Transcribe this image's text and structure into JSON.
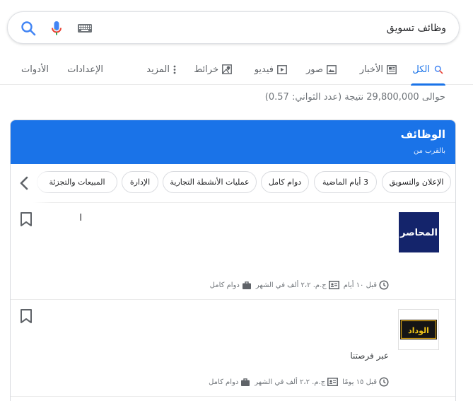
{
  "search": {
    "value": "وظائف تسويق",
    "placeholder": ""
  },
  "tabs": [
    {
      "label": "الكل",
      "icon": "search-icon",
      "active": true
    },
    {
      "label": "الأخبار",
      "icon": "news-icon"
    },
    {
      "label": "صور",
      "icon": "image-icon"
    },
    {
      "label": "فيديو",
      "icon": "video-icon"
    },
    {
      "label": "خرائط",
      "icon": "map-icon"
    },
    {
      "label": "المزيد",
      "icon": "more-vert-icon"
    },
    {
      "label": "الإعدادات"
    },
    {
      "label": "الأدوات"
    }
  ],
  "stats": "حوالى 29,800,000 نتيجة (عدد الثواني: 0.57)",
  "jobs_card": {
    "title": "الوظائف",
    "subtitle": "بالقرب من",
    "chips": [
      "الإعلان والتسويق",
      "3 أيام الماضية",
      "دوام كامل",
      "عمليات الأنشطة التجارية",
      "الإدارة",
      "المبيعات والتجزئة"
    ],
    "jobs": [
      {
        "title": "ا",
        "company": "",
        "posted": "قبل ١٠ أيام",
        "salary": "ج.م. ٢،٢ ألف في الشهر",
        "type": "دوام كامل",
        "logo_text": "المحاصر"
      },
      {
        "title": "",
        "company": "عبر فرصتنا",
        "posted": "قبل ١٥ يومًا",
        "salary": "ج.م. ٢،٢ ألف في الشهر",
        "type": "دوام كامل",
        "logo_text": "الوداد"
      }
    ]
  },
  "colors": {
    "accent": "#1a73e8",
    "text_secondary": "#70757a"
  }
}
